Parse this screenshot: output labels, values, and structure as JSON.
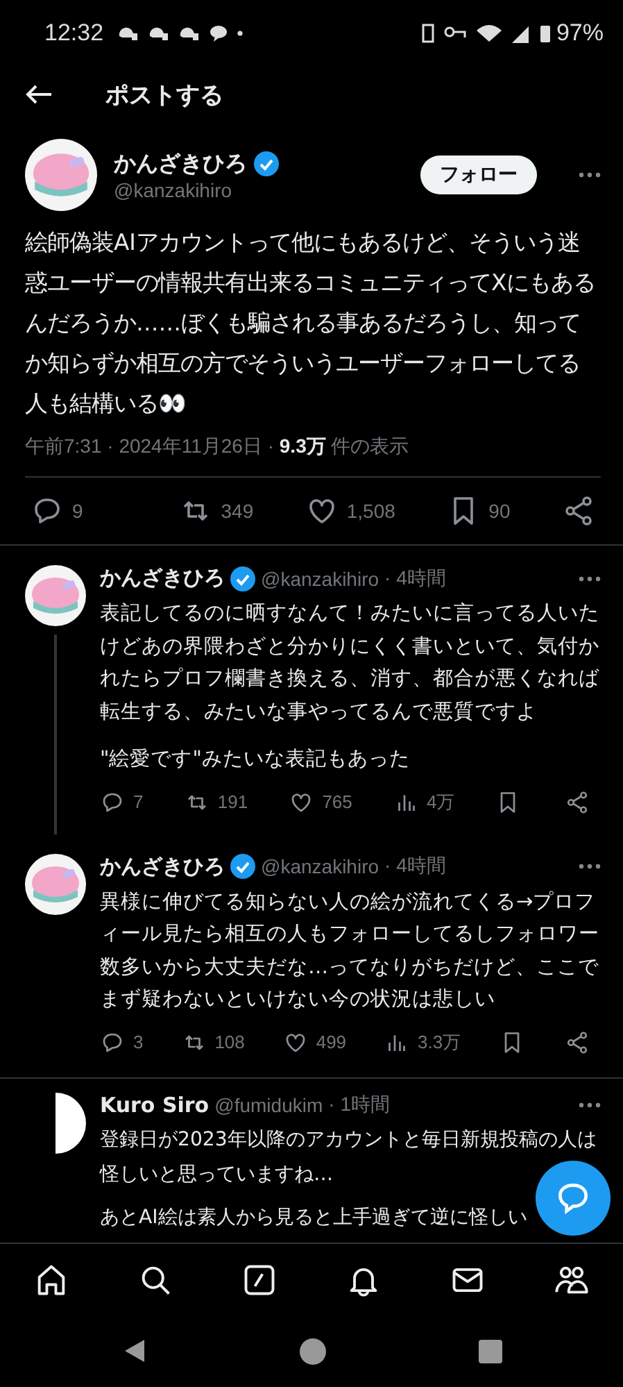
{
  "status_bar": {
    "time": "12:32",
    "battery": "97%"
  },
  "header": {
    "title": "ポストする"
  },
  "post": {
    "name": "かんざきひろ",
    "verified": true,
    "handle": "@kanzakihiro",
    "follow_label": "フォロー",
    "text": "絵師偽装AIアカウントって他にもあるけど、そういう迷惑ユーザーの情報共有出来るコミュニティってXにもあるんだろうか……ぼくも騙される事あるだろうし、知ってか知らずか相互の方でそういうユーザーフォローしてる人も結構いる👀",
    "time": "午前7:31 · 2024年11月26日 · ",
    "views": "9.3万",
    "views_label": " 件の表示",
    "replies": "9",
    "reposts": "349",
    "likes": "1,508",
    "bookmarks": "90"
  },
  "replies": [
    {
      "name": "かんざきひろ",
      "verified": true,
      "handle": "@kanzakihiro",
      "time": "· 4時間",
      "avatar": {
        "kind": "pink"
      },
      "thread_line": true,
      "paragraphs": [
        "表記してるのに晒すなんて！みたいに言ってる人いたけどあの界隈わざと分かりにくく書いといて、気付かれたらプロフ欄書き換える、消す、都合が悪くなれば転生する、みたいな事やってるんで悪質ですよ",
        "\"絵愛です\"みたいな表記もあった"
      ],
      "replies": "7",
      "reposts": "191",
      "likes": "765",
      "views": "4万",
      "divider": false
    },
    {
      "name": "かんざきひろ",
      "verified": true,
      "handle": "@kanzakihiro",
      "time": "· 4時間",
      "avatar": {
        "kind": "pink"
      },
      "thread_line": false,
      "paragraphs": [
        "異様に伸びてる知らない人の絵が流れてくる→プロフィール見たら相互の人もフォローしてるしフォロワー数多いから大丈夫だな…ってなりがちだけど、ここでまず疑わないといけない今の状況は悲しい"
      ],
      "replies": "3",
      "reposts": "108",
      "likes": "499",
      "views": "3.3万",
      "divider": true
    },
    {
      "name": "Kuro Siro",
      "verified": false,
      "handle": "@fumidukim",
      "time": "· 1時間",
      "avatar": {
        "kind": "half"
      },
      "thread_line": false,
      "paragraphs": [
        "登録日が2023年以降のアカウントと毎日新規投稿の人は怪しいと思っていますね…",
        "あとAI絵は素人から見ると上手過ぎて逆に怪しい"
      ]
    }
  ]
}
